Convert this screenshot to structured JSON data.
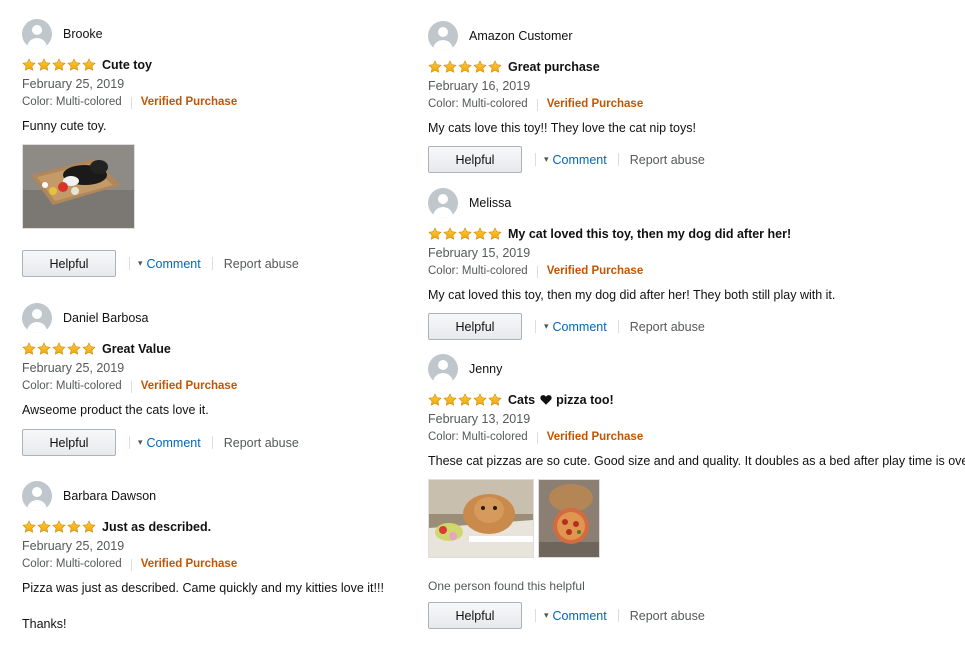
{
  "colors": {
    "star": "#f0a30a",
    "verified": "#c45500",
    "link": "#0066c0",
    "muted": "#565959"
  },
  "icons": {
    "avatar": "user-silhouette-icon",
    "star": "star-icon",
    "heart": "heart-icon",
    "chevron": "chevron-down-icon"
  },
  "actions": {
    "helpful": "Helpful",
    "comment": "Comment",
    "report": "Report abuse"
  },
  "reviews": [
    {
      "author": "Brooke",
      "rating": 5,
      "title": "Cute toy",
      "date": "February 25, 2019",
      "color": "Color: Multi-colored",
      "verified": "Verified Purchase",
      "text": "Funny cute toy."
    },
    {
      "author": "Daniel Barbosa",
      "rating": 5,
      "title": "Great Value",
      "date": "February 25, 2019",
      "color": "Color: Multi-colored",
      "verified": "Verified Purchase",
      "text": "Awseome product the cats love it."
    },
    {
      "author": "Barbara Dawson",
      "rating": 5,
      "title": "Just as described.",
      "date": "February 25, 2019",
      "color": "Color: Multi-colored",
      "verified": "Verified Purchase",
      "text": "Pizza was just as described. Came quickly and my kitties love it!!!",
      "text2": "Thanks!"
    },
    {
      "author": "Amazon Customer",
      "rating": 5,
      "title": "Great purchase",
      "date": "February 16, 2019",
      "color": "Color: Multi-colored",
      "verified": "Verified Purchase",
      "text": "My cats love this toy!! They love the cat nip toys!"
    },
    {
      "author": "Melissa",
      "rating": 5,
      "title": "My cat loved this toy, then my dog did after her!",
      "date": "February 15, 2019",
      "color": "Color: Multi-colored",
      "verified": "Verified Purchase",
      "text": "My cat loved this toy, then my dog did after her! They both still play with it."
    },
    {
      "author": "Jenny",
      "rating": 5,
      "title_pre": "Cats",
      "title_post": "pizza too!",
      "date": "February 13, 2019",
      "color": "Color: Multi-colored",
      "verified": "Verified Purchase",
      "text": "These cat pizzas are so cute. Good size and and quality. It doubles as a bed after play time is over.",
      "helpful_count": "One person found this helpful"
    }
  ]
}
